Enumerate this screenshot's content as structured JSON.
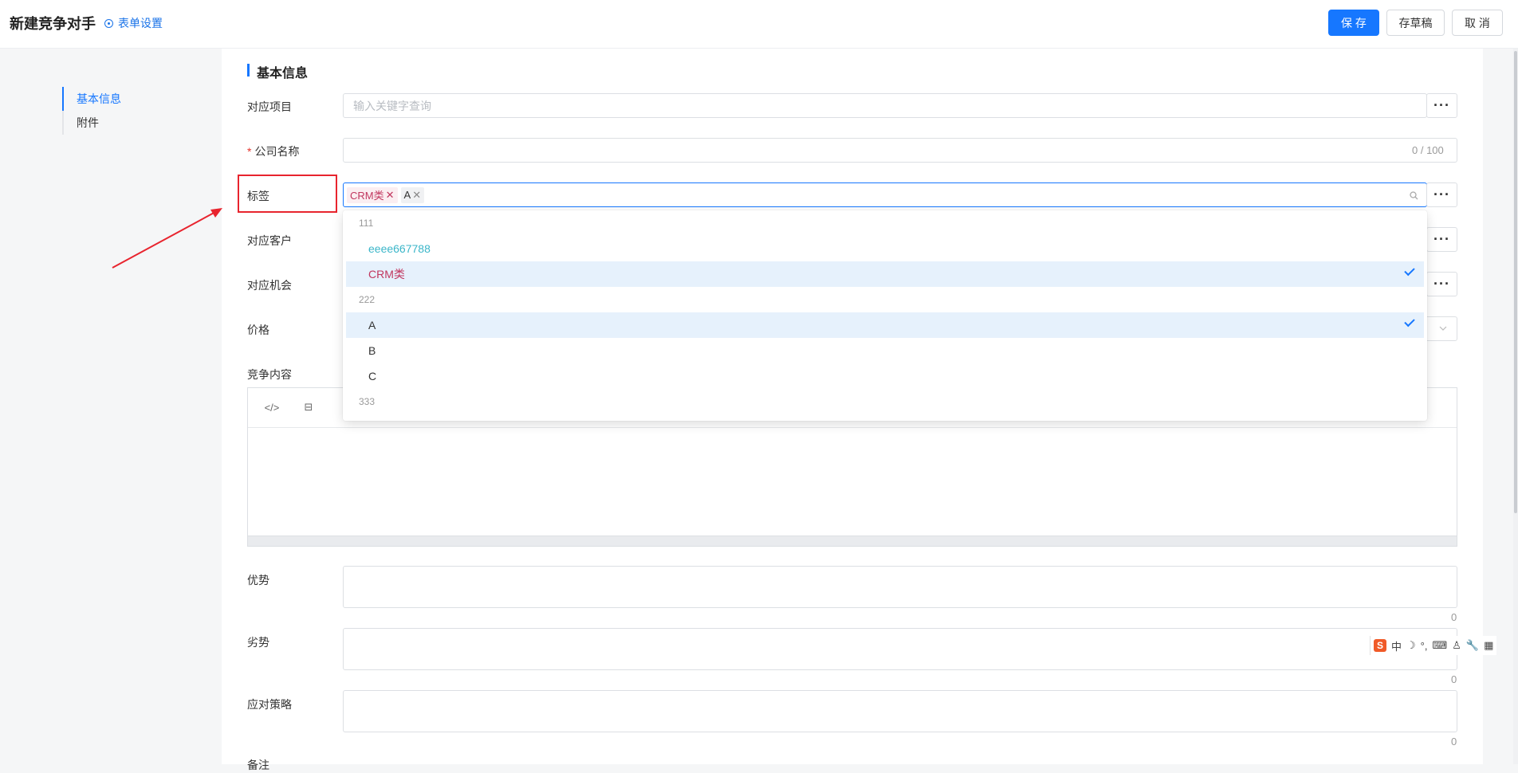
{
  "header": {
    "title": "新建竞争对手",
    "form_settings": "表单设置",
    "save": "保 存",
    "draft": "存草稿",
    "cancel": "取 消"
  },
  "nav": [
    {
      "label": "基本信息",
      "active": true
    },
    {
      "label": "附件",
      "active": false
    }
  ],
  "section_title": "基本信息",
  "fields": {
    "project": {
      "label": "对应项目",
      "placeholder": "输入关键字查询"
    },
    "company": {
      "label": "公司名称",
      "required_mark": "*",
      "counter": "0 / 100"
    },
    "tags": {
      "label": "标签",
      "chips": [
        "CRM类",
        "A"
      ]
    },
    "customer": {
      "label": "对应客户"
    },
    "opportunity": {
      "label": "对应机会"
    },
    "price": {
      "label": "价格"
    },
    "content": {
      "label": "竞争内容"
    },
    "advantage": {
      "label": "优势",
      "counter": "0"
    },
    "disadvantage": {
      "label": "劣势",
      "counter": "0"
    },
    "strategy": {
      "label": "应对策略",
      "counter": "0"
    },
    "remark": {
      "label": "备注"
    }
  },
  "more_label": "···",
  "dropdown": {
    "rows": [
      {
        "type": "group",
        "label": "111"
      },
      {
        "type": "option",
        "label": "eeee667788",
        "selected": false
      },
      {
        "type": "option",
        "label": "CRM类",
        "selected": true
      },
      {
        "type": "group",
        "label": "222"
      },
      {
        "type": "option",
        "label": "A",
        "selected": true
      },
      {
        "type": "option",
        "label": "B",
        "selected": false
      },
      {
        "type": "option",
        "label": "C",
        "selected": false
      },
      {
        "type": "group",
        "label": "333"
      }
    ]
  },
  "editor_toolbar": {
    "code": "</>",
    "layout": "⊟"
  },
  "ime": {
    "logo": "S",
    "mode": "中",
    "icons": [
      "☽",
      "°,",
      "⌨",
      "♙",
      "🔧",
      "▦"
    ]
  },
  "colors": {
    "accent": "#1677ff",
    "annotation": "#e8242e",
    "crm_tag": "#c1375f",
    "teal_option": "#3bb6c9"
  }
}
